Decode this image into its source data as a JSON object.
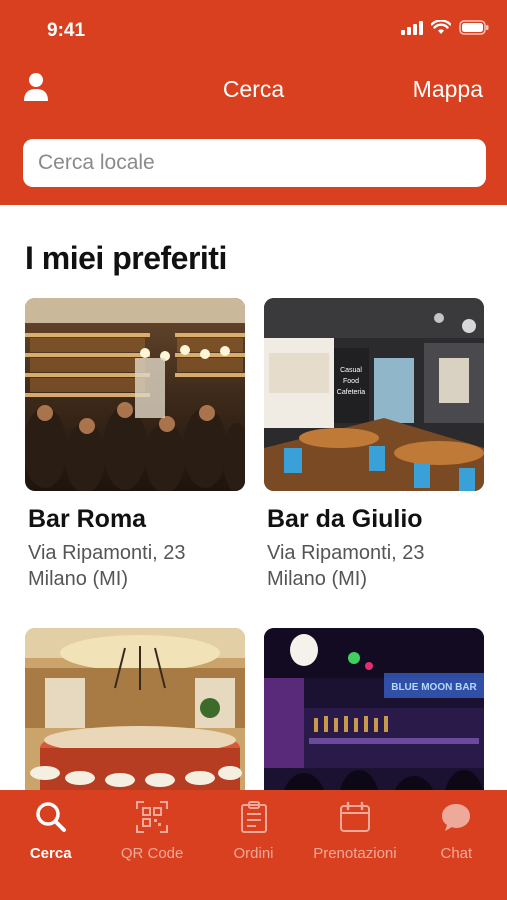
{
  "status": {
    "time": "9:41"
  },
  "nav": {
    "title": "Cerca",
    "map_label": "Mappa"
  },
  "search": {
    "placeholder": "Cerca locale",
    "value": ""
  },
  "favorites": {
    "title": "I miei preferiti",
    "items": [
      {
        "name": "Bar Roma",
        "address_line1": "Via Ripamonti, 23",
        "address_line2": "Milano (MI)"
      },
      {
        "name": "Bar da Giulio",
        "address_line1": "Via Ripamonti, 23",
        "address_line2": "Milano (MI)"
      },
      {
        "name": "",
        "address_line1": "",
        "address_line2": ""
      },
      {
        "name": "",
        "address_line1": "",
        "address_line2": ""
      }
    ],
    "sign_text": [
      "Casual",
      "Food",
      "Cafeteria"
    ],
    "neon_text": "BLUE MOON BAR"
  },
  "tabs": [
    {
      "label": "Cerca",
      "icon": "search-icon",
      "active": true
    },
    {
      "label": "QR Code",
      "icon": "qr-code-icon",
      "active": false
    },
    {
      "label": "Ordini",
      "icon": "clipboard-icon",
      "active": false
    },
    {
      "label": "Prenotazioni",
      "icon": "calendar-icon",
      "active": false
    },
    {
      "label": "Chat",
      "icon": "chat-bubble-icon",
      "active": false
    }
  ],
  "colors": {
    "brand": "#d9401f",
    "text": "#111111",
    "subtext": "#555555"
  }
}
